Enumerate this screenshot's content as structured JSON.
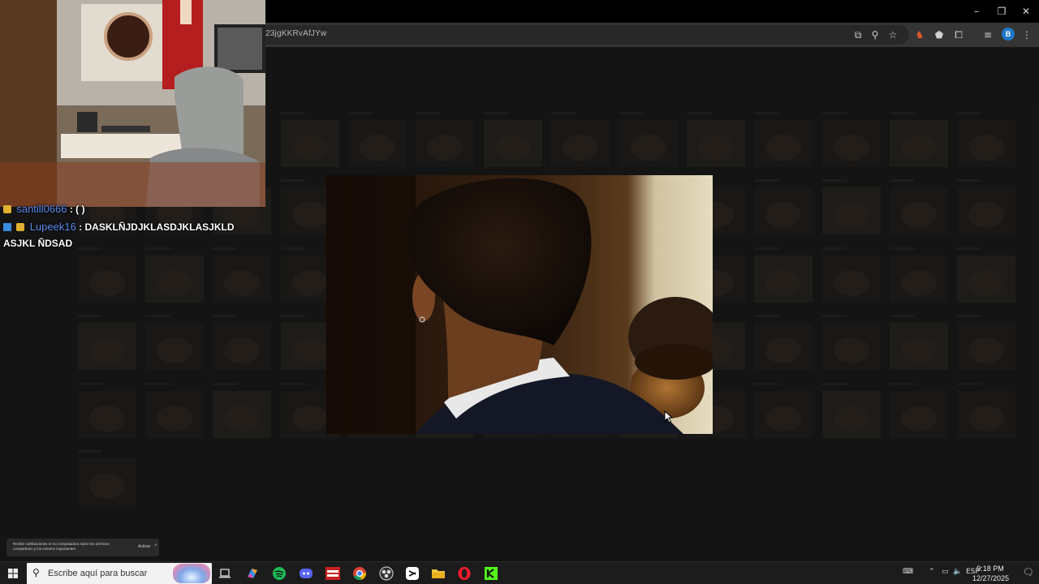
{
  "browser": {
    "url_fragment": "23jgKKRvAfJYw",
    "window_controls": {
      "minimize": "–",
      "restore": "❐",
      "close": "✕"
    },
    "toolbar_icons": [
      "cast-icon",
      "zoom-icon",
      "bookmark-star-icon",
      "extension-fox-icon",
      "extension-shield-icon",
      "extensions-puzzle-icon",
      "media-controls-icon",
      "profile-icon",
      "menu-kebab-icon"
    ],
    "profile_initial": "B"
  },
  "chat": {
    "lines": [
      {
        "user": "santill0666",
        "message": ": ( )"
      },
      {
        "user": "Lupeek16",
        "message": ": DASKLÑJDJKLASDJKLASJKLD ASJKL ÑDSAD"
      }
    ]
  },
  "toast": {
    "text": "Recibe notificaciones en tu computadora sobre los archivos compartidos y los eventos importantes.",
    "action": "Activar",
    "close": "×"
  },
  "taskbar": {
    "search_placeholder": "Escribe aquí para buscar",
    "apps": [
      "task-view-icon",
      "copilot-icon",
      "spotify-icon",
      "discord-icon",
      "voicemod-icon",
      "chrome-icon",
      "obs-icon",
      "capcut-icon",
      "file-explorer-icon",
      "opera-icon",
      "kick-icon"
    ],
    "language": "ESP",
    "time": "9:18 PM",
    "date": "12/27/2025"
  },
  "colors": {
    "page_bg": "#202020",
    "chat_user": "#5a8cf0",
    "spotify": "#1db954",
    "discord": "#5865f2",
    "kick": "#53fc18",
    "opera": "#ff1b2d"
  }
}
